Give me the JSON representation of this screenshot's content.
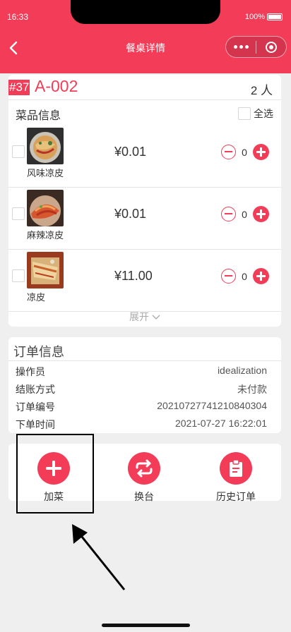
{
  "status_bar": {
    "time": "16:33",
    "battery": "100%"
  },
  "nav": {
    "title": "餐桌详情"
  },
  "table": {
    "number": "#37",
    "name": "A-002",
    "guests": "2 人"
  },
  "dishes_section": {
    "title": "菜品信息",
    "select_all": "全选",
    "expand": "展开",
    "items": [
      {
        "name": "风味凉皮",
        "price": "¥0.01",
        "qty": "0"
      },
      {
        "name": "麻辣凉皮",
        "price": "¥0.01",
        "qty": "0"
      },
      {
        "name": "凉皮",
        "price": "¥11.00",
        "qty": "0"
      }
    ]
  },
  "order_info": {
    "title": "订单信息",
    "rows": [
      {
        "label": "操作员",
        "value": "idealization"
      },
      {
        "label": "结账方式",
        "value": "未付款"
      },
      {
        "label": "订单编号",
        "value": "20210727741210840304"
      },
      {
        "label": "下单时间",
        "value": "2021-07-27 16:22:01"
      }
    ]
  },
  "actions": [
    {
      "label": "加菜",
      "icon": "plus-icon"
    },
    {
      "label": "换台",
      "icon": "swap-icon"
    },
    {
      "label": "历史订单",
      "icon": "clipboard-icon"
    }
  ],
  "colors": {
    "brand": "#f23c58",
    "background": "#efefef"
  }
}
